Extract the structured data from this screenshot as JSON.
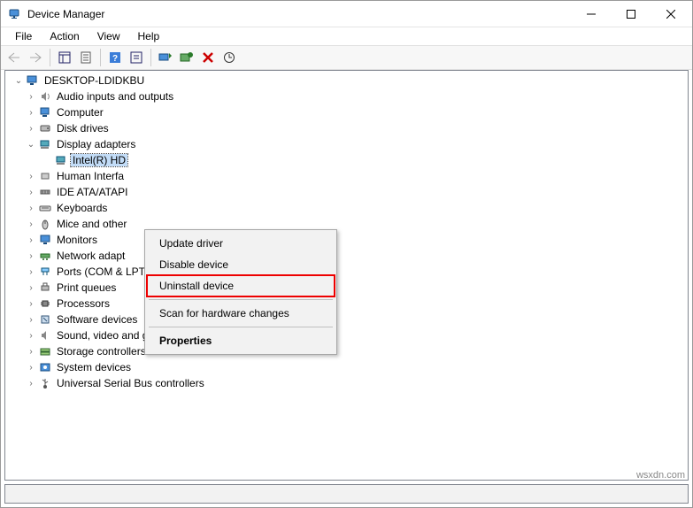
{
  "window": {
    "title": "Device Manager"
  },
  "menu": {
    "file": "File",
    "action": "Action",
    "view": "View",
    "help": "Help"
  },
  "tree": {
    "root": "DESKTOP-LDIDKBU",
    "audio": "Audio inputs and outputs",
    "computer": "Computer",
    "disk": "Disk drives",
    "display": "Display adapters",
    "display_intel": "Intel(R) HD",
    "hid": "Human Interfa",
    "ide": "IDE ATA/ATAPI",
    "keyboards": "Keyboards",
    "mice": "Mice and other",
    "monitors": "Monitors",
    "network": "Network adapt",
    "ports": "Ports (COM & LPT)",
    "printq": "Print queues",
    "processors": "Processors",
    "softdev": "Software devices",
    "sound": "Sound, video and game controllers",
    "storage": "Storage controllers",
    "system": "System devices",
    "usb": "Universal Serial Bus controllers"
  },
  "context": {
    "update": "Update driver",
    "disable": "Disable device",
    "uninstall": "Uninstall device",
    "scan": "Scan for hardware changes",
    "properties": "Properties"
  },
  "attribution": "wsxdn.com"
}
